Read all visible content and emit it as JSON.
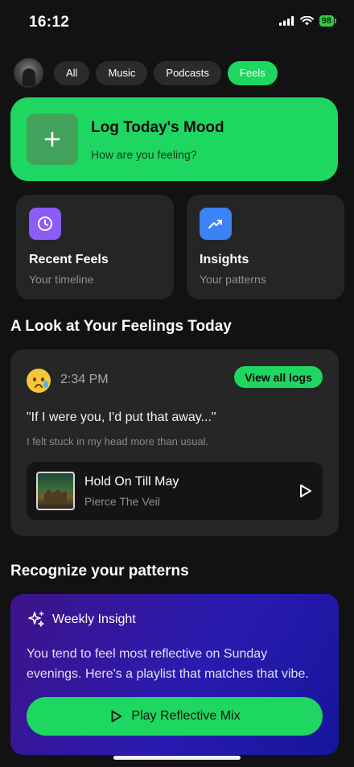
{
  "status_bar": {
    "time": "16:12",
    "battery": "98",
    "icons": [
      "cellular-signal-icon",
      "wifi-icon",
      "battery-icon"
    ]
  },
  "filters": {
    "items": [
      {
        "label": "All",
        "active": false
      },
      {
        "label": "Music",
        "active": false
      },
      {
        "label": "Podcasts",
        "active": false
      },
      {
        "label": "Feels",
        "active": true
      }
    ]
  },
  "mood_card": {
    "title": "Log Today's Mood",
    "subtitle": "How are you feeling?",
    "icon": "plus-icon"
  },
  "tiles": [
    {
      "title": "Recent Feels",
      "subtitle": "Your timeline",
      "icon": "clock-icon",
      "color": "#8b5cf6"
    },
    {
      "title": "Insights",
      "subtitle": "Your patterns",
      "icon": "trending-up-icon",
      "color": "#3b82f6"
    }
  ],
  "feelings_section": {
    "title": "A Look at Your Feelings Today",
    "log": {
      "emoji": "crying-face-icon",
      "time": "2:34 PM",
      "view_all_label": "View all logs",
      "quote": "\"If I were you, I'd put that away...\"",
      "note": "I felt stuck in my head more than usual.",
      "track": {
        "title": "Hold On Till May",
        "artist": "Pierce The Veil"
      }
    }
  },
  "patterns_section": {
    "title": "Recognize your patterns",
    "insight": {
      "label": "Weekly Insight",
      "text": "You tend to feel most reflective on Sunday evenings. Here's a playlist that matches that vibe.",
      "button_label": "Play Reflective Mix"
    }
  },
  "colors": {
    "background": "#121212",
    "accent": "#1ed760",
    "card": "#262626"
  }
}
